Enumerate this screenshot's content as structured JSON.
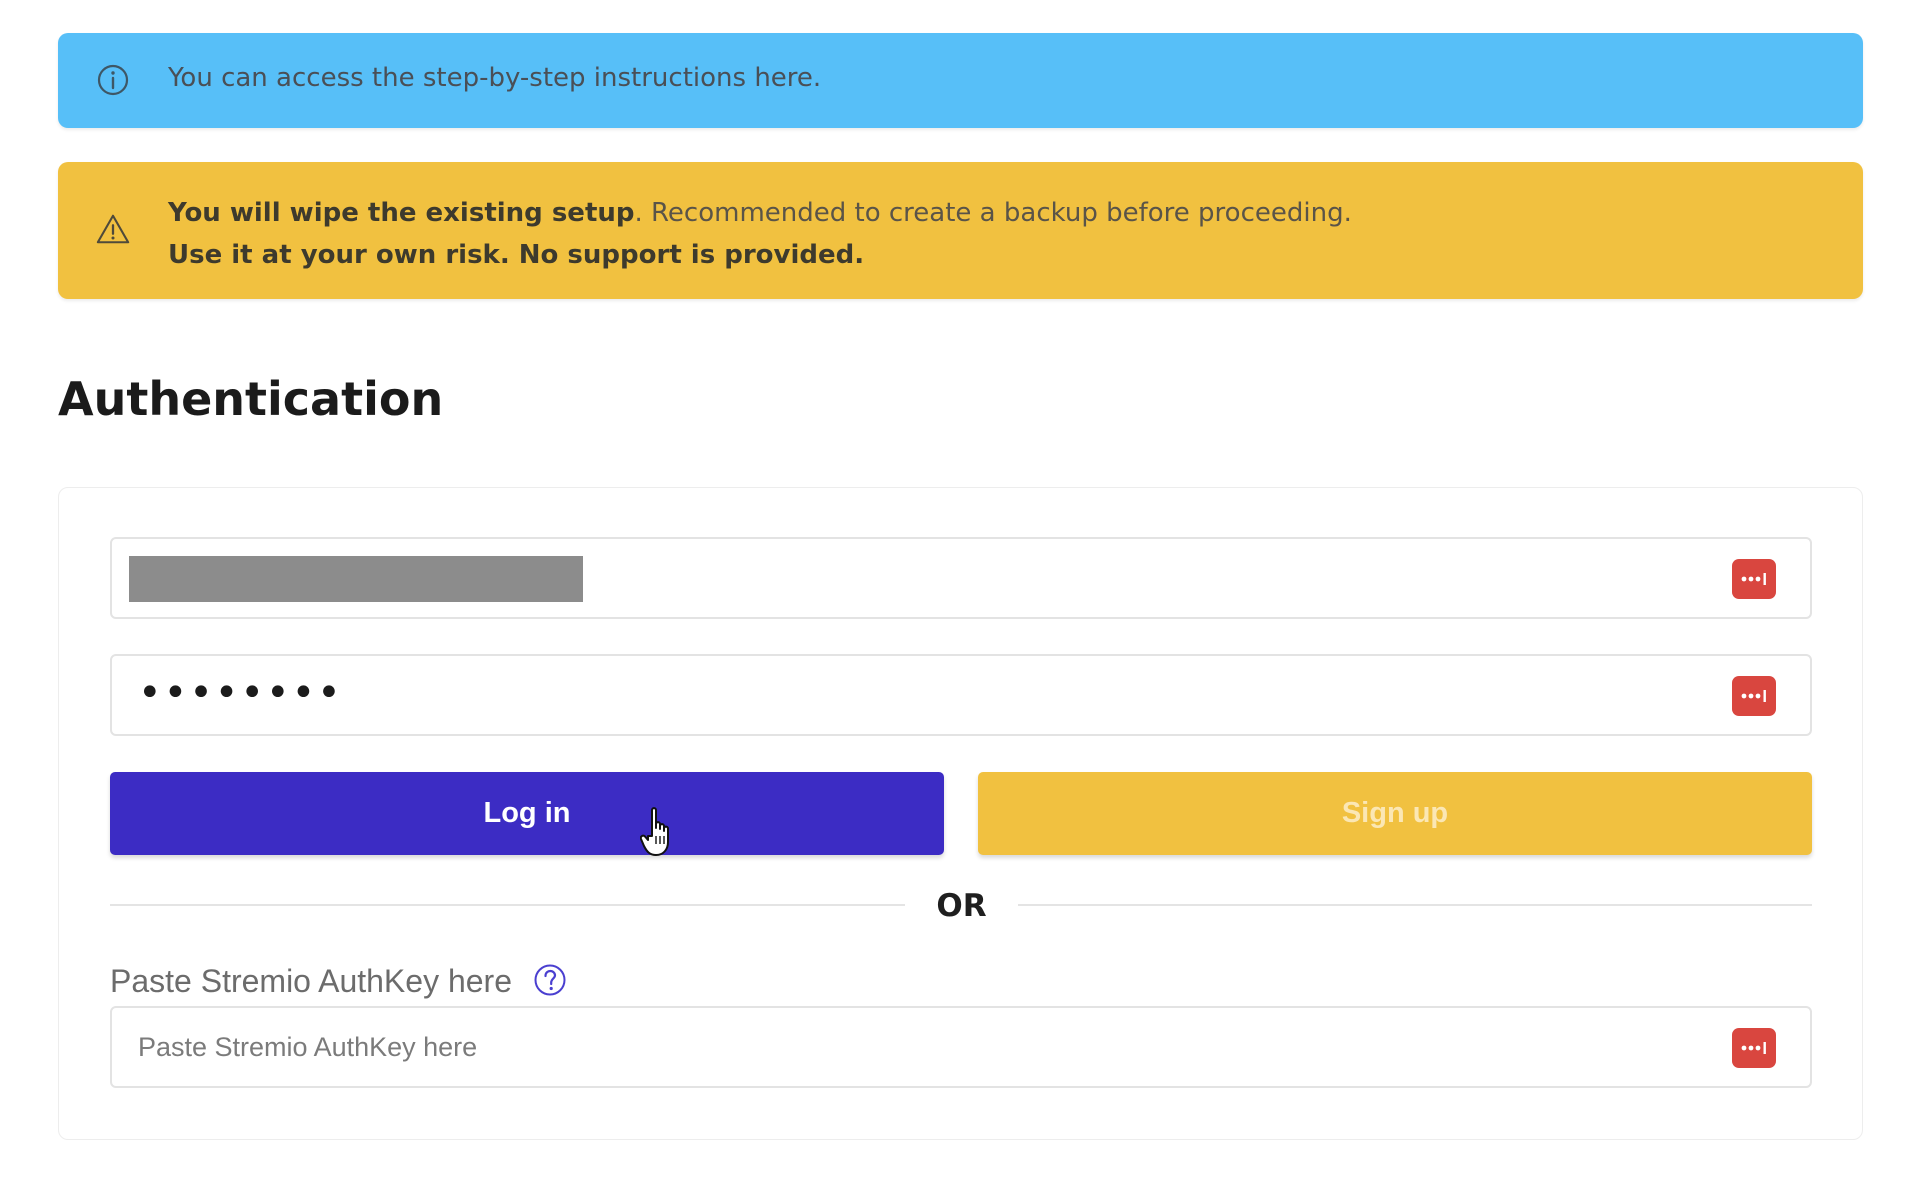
{
  "info_alert": {
    "text": "You can access the step-by-step instructions here.",
    "icon": "info-circle-icon",
    "color": "#57bff8"
  },
  "warning_alert": {
    "bold_text": "You will wipe the existing setup",
    "text": ". Recommended to create a backup before proceeding.",
    "second_line": "Use it at your own risk. No support is provided.",
    "icon": "warning-triangle-icon",
    "color": "#f1c140"
  },
  "section": {
    "title": "Authentication"
  },
  "form": {
    "email": {
      "value_redacted": true
    },
    "password": {
      "value_masked": "••••••••"
    },
    "login_label": "Log in",
    "signup_label": "Sign up",
    "divider": "OR",
    "authkey": {
      "label": "Paste Stremio AuthKey here",
      "placeholder": "Paste Stremio AuthKey here",
      "help_icon": "question-circle-icon"
    },
    "password_manager_icon": "password-manager-icon"
  },
  "colors": {
    "primary": "#3c2cc4",
    "secondary": "#f1c140",
    "password_manager": "#d9463f"
  }
}
